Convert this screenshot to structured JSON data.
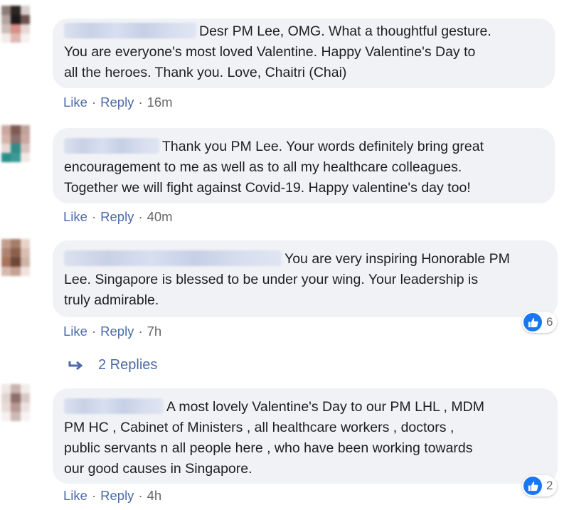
{
  "comments": [
    {
      "text": "Desr PM Lee, OMG. What a thoughtful gesture.\nYou are everyone's most loved Valentine. Happy Valentine's Day to\nall the heroes. Thank you. Love, Chaitri (Chai)",
      "actions": {
        "like": "Like",
        "reply": "Reply",
        "time": "16m"
      }
    },
    {
      "text": "Thank you PM Lee. Your words definitely bring great\nencouragement to me as well as to all my healthcare colleagues.\nTogether we will fight against Covid-19. Happy valentine's day too!",
      "actions": {
        "like": "Like",
        "reply": "Reply",
        "time": "40m"
      }
    },
    {
      "text": "You are very inspiring Honorable PM\nLee. Singapore is blessed to be under your wing. Your leadership is\ntruly admirable.",
      "actions": {
        "like": "Like",
        "reply": "Reply",
        "time": "7h"
      },
      "reaction_count": "6"
    },
    {
      "text": "A most lovely Valentine's Day to our PM LHL , MDM\nPM HC , Cabinet of Ministers , all healthcare workers , doctors ,\npublic servants n all people here , who have been working towards\nour good causes in Singapore.",
      "actions": {
        "like": "Like",
        "reply": "Reply",
        "time": "4h"
      },
      "reaction_count": "2"
    }
  ],
  "replies_link": "2 Replies",
  "dot": "·",
  "colors": {
    "bubble": "#f0f2f5",
    "link": "#4b6aa8",
    "meta": "#65676b",
    "like_blue": "#1877f2"
  },
  "icons": {
    "like": "thumbs-up-icon",
    "reply_arrow": "reply-arrow-icon"
  }
}
